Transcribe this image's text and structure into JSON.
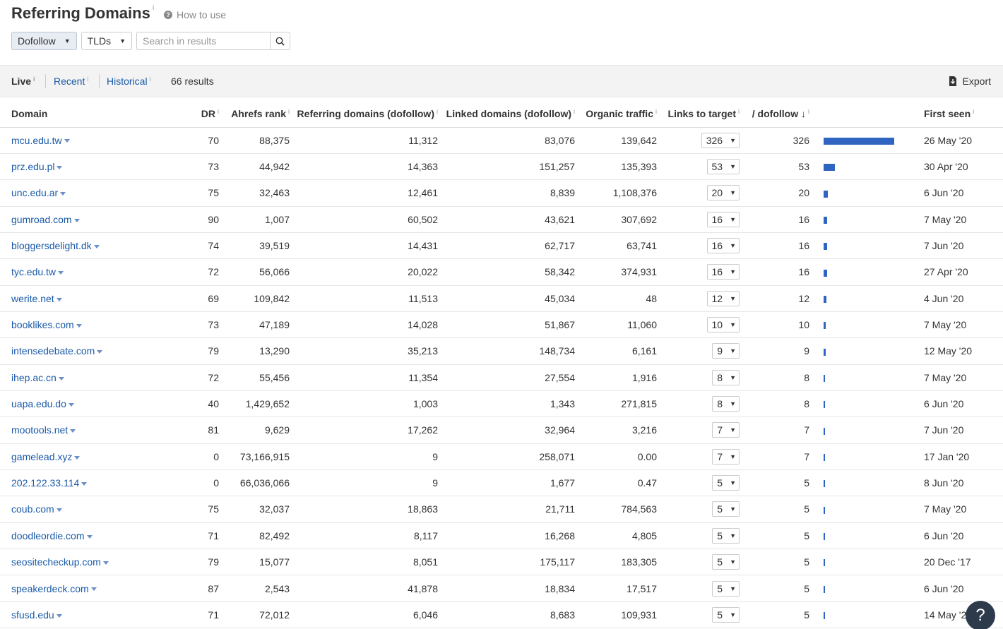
{
  "header": {
    "title": "Referring Domains",
    "title_sup": "i",
    "how_to_use": "How to use",
    "help_icon_glyph": "?"
  },
  "filters": {
    "dofollow": "Dofollow",
    "tlds": "TLDs",
    "search_placeholder": "Search in results",
    "search_value": ""
  },
  "tabs": {
    "live": "Live",
    "recent": "Recent",
    "historical": "Historical",
    "sup": "i",
    "results": "66 results",
    "export": "Export"
  },
  "columns": {
    "domain": "Domain",
    "dr": "DR",
    "ahrefs_rank": "Ahrefs rank",
    "referring_domains": "Referring domains (dofollow)",
    "linked_domains": "Linked domains (dofollow)",
    "organic_traffic": "Organic traffic",
    "links_to_target": "Links to target",
    "dofollow": "/ dofollow ↓",
    "first_seen": "First seen",
    "sup": "i"
  },
  "rows": [
    {
      "domain": "mcu.edu.tw",
      "dr": "70",
      "ar": "88,375",
      "rd": "11,312",
      "ld": "83,076",
      "ot": "139,642",
      "lt": "326",
      "df": "326",
      "bar": 326,
      "fs": "26 May '20"
    },
    {
      "domain": "prz.edu.pl",
      "dr": "73",
      "ar": "44,942",
      "rd": "14,363",
      "ld": "151,257",
      "ot": "135,393",
      "lt": "53",
      "df": "53",
      "bar": 53,
      "fs": "30 Apr '20"
    },
    {
      "domain": "unc.edu.ar",
      "dr": "75",
      "ar": "32,463",
      "rd": "12,461",
      "ld": "8,839",
      "ot": "1,108,376",
      "lt": "20",
      "df": "20",
      "bar": 20,
      "fs": "6 Jun '20"
    },
    {
      "domain": "gumroad.com",
      "dr": "90",
      "ar": "1,007",
      "rd": "60,502",
      "ld": "43,621",
      "ot": "307,692",
      "lt": "16",
      "df": "16",
      "bar": 16,
      "fs": "7 May '20"
    },
    {
      "domain": "bloggersdelight.dk",
      "dr": "74",
      "ar": "39,519",
      "rd": "14,431",
      "ld": "62,717",
      "ot": "63,741",
      "lt": "16",
      "df": "16",
      "bar": 16,
      "fs": "7 Jun '20"
    },
    {
      "domain": "tyc.edu.tw",
      "dr": "72",
      "ar": "56,066",
      "rd": "20,022",
      "ld": "58,342",
      "ot": "374,931",
      "lt": "16",
      "df": "16",
      "bar": 16,
      "fs": "27 Apr '20"
    },
    {
      "domain": "werite.net",
      "dr": "69",
      "ar": "109,842",
      "rd": "11,513",
      "ld": "45,034",
      "ot": "48",
      "lt": "12",
      "df": "12",
      "bar": 12,
      "fs": "4 Jun '20"
    },
    {
      "domain": "booklikes.com",
      "dr": "73",
      "ar": "47,189",
      "rd": "14,028",
      "ld": "51,867",
      "ot": "11,060",
      "lt": "10",
      "df": "10",
      "bar": 10,
      "fs": "7 May '20"
    },
    {
      "domain": "intensedebate.com",
      "dr": "79",
      "ar": "13,290",
      "rd": "35,213",
      "ld": "148,734",
      "ot": "6,161",
      "lt": "9",
      "df": "9",
      "bar": 9,
      "fs": "12 May '20"
    },
    {
      "domain": "ihep.ac.cn",
      "dr": "72",
      "ar": "55,456",
      "rd": "11,354",
      "ld": "27,554",
      "ot": "1,916",
      "lt": "8",
      "df": "8",
      "bar": 8,
      "fs": "7 May '20"
    },
    {
      "domain": "uapa.edu.do",
      "dr": "40",
      "ar": "1,429,652",
      "rd": "1,003",
      "ld": "1,343",
      "ot": "271,815",
      "lt": "8",
      "df": "8",
      "bar": 8,
      "fs": "6 Jun '20"
    },
    {
      "domain": "mootools.net",
      "dr": "81",
      "ar": "9,629",
      "rd": "17,262",
      "ld": "32,964",
      "ot": "3,216",
      "lt": "7",
      "df": "7",
      "bar": 7,
      "fs": "7 Jun '20"
    },
    {
      "domain": "gamelead.xyz",
      "dr": "0",
      "ar": "73,166,915",
      "rd": "9",
      "ld": "258,071",
      "ot": "0.00",
      "lt": "7",
      "df": "7",
      "bar": 7,
      "fs": "17 Jan '20"
    },
    {
      "domain": "202.122.33.114",
      "dr": "0",
      "ar": "66,036,066",
      "rd": "9",
      "ld": "1,677",
      "ot": "0.47",
      "lt": "5",
      "df": "5",
      "bar": 5,
      "fs": "8 Jun '20"
    },
    {
      "domain": "coub.com",
      "dr": "75",
      "ar": "32,037",
      "rd": "18,863",
      "ld": "21,711",
      "ot": "784,563",
      "lt": "5",
      "df": "5",
      "bar": 5,
      "fs": "7 May '20"
    },
    {
      "domain": "doodleordie.com",
      "dr": "71",
      "ar": "82,492",
      "rd": "8,117",
      "ld": "16,268",
      "ot": "4,805",
      "lt": "5",
      "df": "5",
      "bar": 5,
      "fs": "6 Jun '20"
    },
    {
      "domain": "seositecheckup.com",
      "dr": "79",
      "ar": "15,077",
      "rd": "8,051",
      "ld": "175,117",
      "ot": "183,305",
      "lt": "5",
      "df": "5",
      "bar": 5,
      "fs": "20 Dec '17"
    },
    {
      "domain": "speakerdeck.com",
      "dr": "87",
      "ar": "2,543",
      "rd": "41,878",
      "ld": "18,834",
      "ot": "17,517",
      "lt": "5",
      "df": "5",
      "bar": 5,
      "fs": "6 Jun '20"
    },
    {
      "domain": "sfusd.edu",
      "dr": "71",
      "ar": "72,012",
      "rd": "6,046",
      "ld": "8,683",
      "ot": "109,931",
      "lt": "5",
      "df": "5",
      "bar": 5,
      "fs": "14 May '20"
    }
  ],
  "colors": {
    "link": "#1a5aa8",
    "bar": "#2f65c1",
    "fab": "#2c3a4b"
  }
}
